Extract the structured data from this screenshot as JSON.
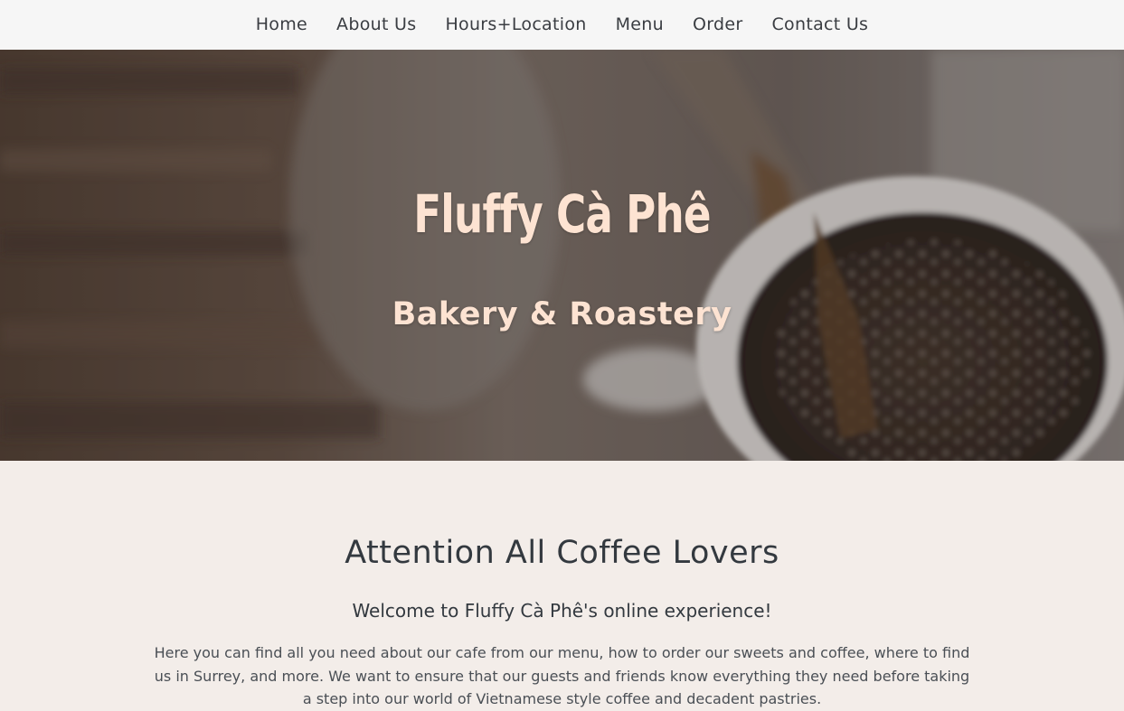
{
  "nav": {
    "items": [
      {
        "label": "Home"
      },
      {
        "label": "About Us"
      },
      {
        "label": "Hours+Location"
      },
      {
        "label": "Menu"
      },
      {
        "label": "Order"
      },
      {
        "label": "Contact Us"
      }
    ]
  },
  "hero": {
    "title": "Fluffy Cà Phê",
    "subtitle": "Bakery & Roastery"
  },
  "intro": {
    "heading": "Attention All Coffee Lovers",
    "welcome": "Welcome to Fluffy Cà Phê's online experience!",
    "body": "Here you can find all you need about our cafe from our menu, how to order our sweets and coffee, where to find us in Surrey, and more. We want to ensure that our guests and friends know everything they need before taking a step into our world of Vietnamese style coffee and decadent pastries."
  },
  "colors": {
    "hero_text": "#fde3d2",
    "page_background": "#f3ede9",
    "nav_background": "#f6f6f6",
    "heading_text": "#33393f"
  }
}
